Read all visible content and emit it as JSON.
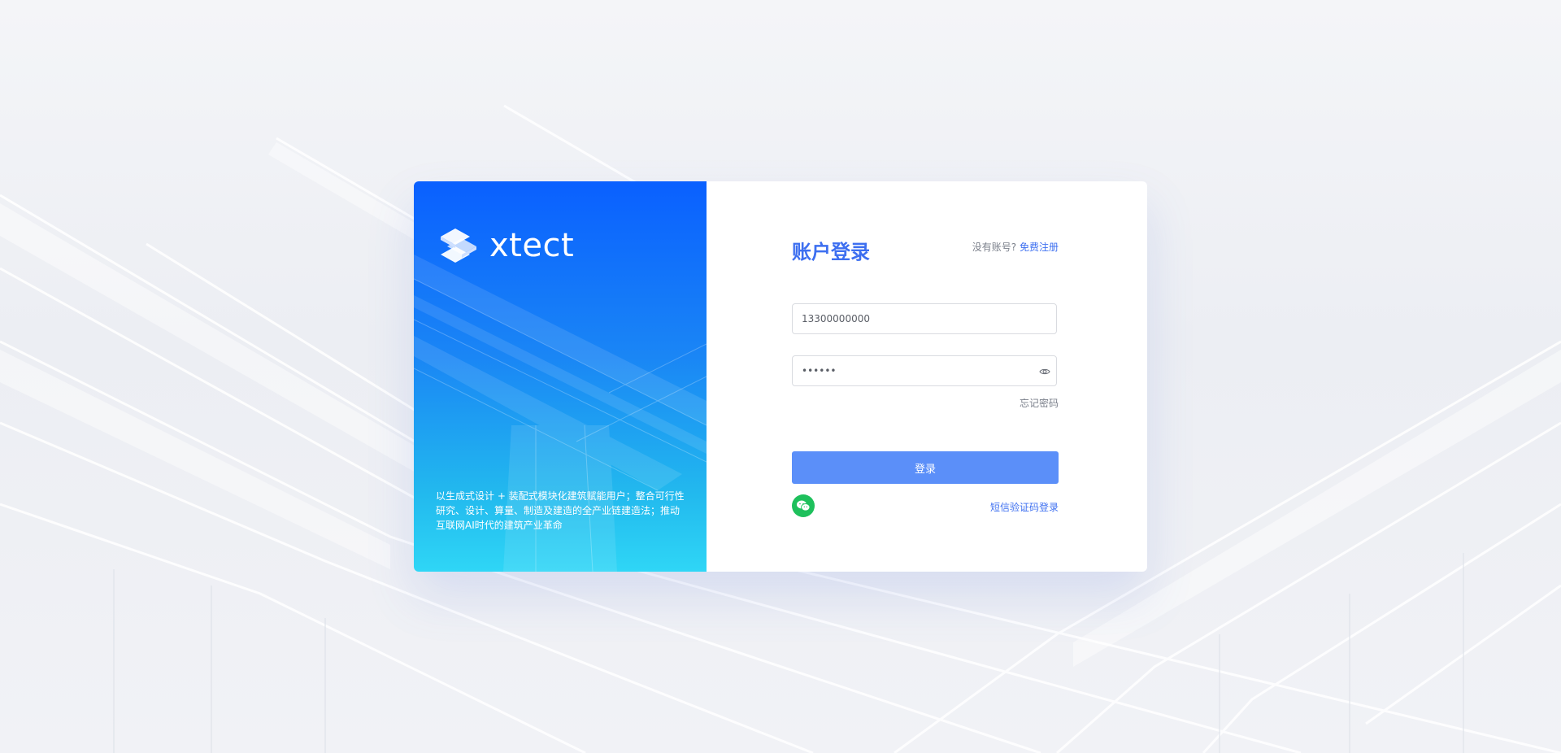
{
  "brand": {
    "name": "xtect",
    "tagline": "以生成式设计 + 装配式模块化建筑赋能用户；整合可行性研究、设计、算量、制造及建造的全产业链建造法；推动互联网AI时代的建筑产业革命"
  },
  "login": {
    "title": "账户登录",
    "no_account_text": "没有账号?",
    "register_link": "免费注册",
    "phone_value": "13300000000",
    "password_value": "••••••",
    "forgot_password": "忘记密码",
    "submit_label": "登录",
    "sms_login_link": "短信验证码登录"
  },
  "icons": {
    "password_toggle": "eye-icon",
    "social_login": "wechat-icon",
    "logo": "xtect-logo-icon"
  },
  "colors": {
    "accent": "#3d6ff0",
    "button": "#5b8ff9",
    "brand_gradient_top": "#0a60ff",
    "brand_gradient_bottom": "#2fd6f6",
    "wechat": "#1ec05c"
  }
}
